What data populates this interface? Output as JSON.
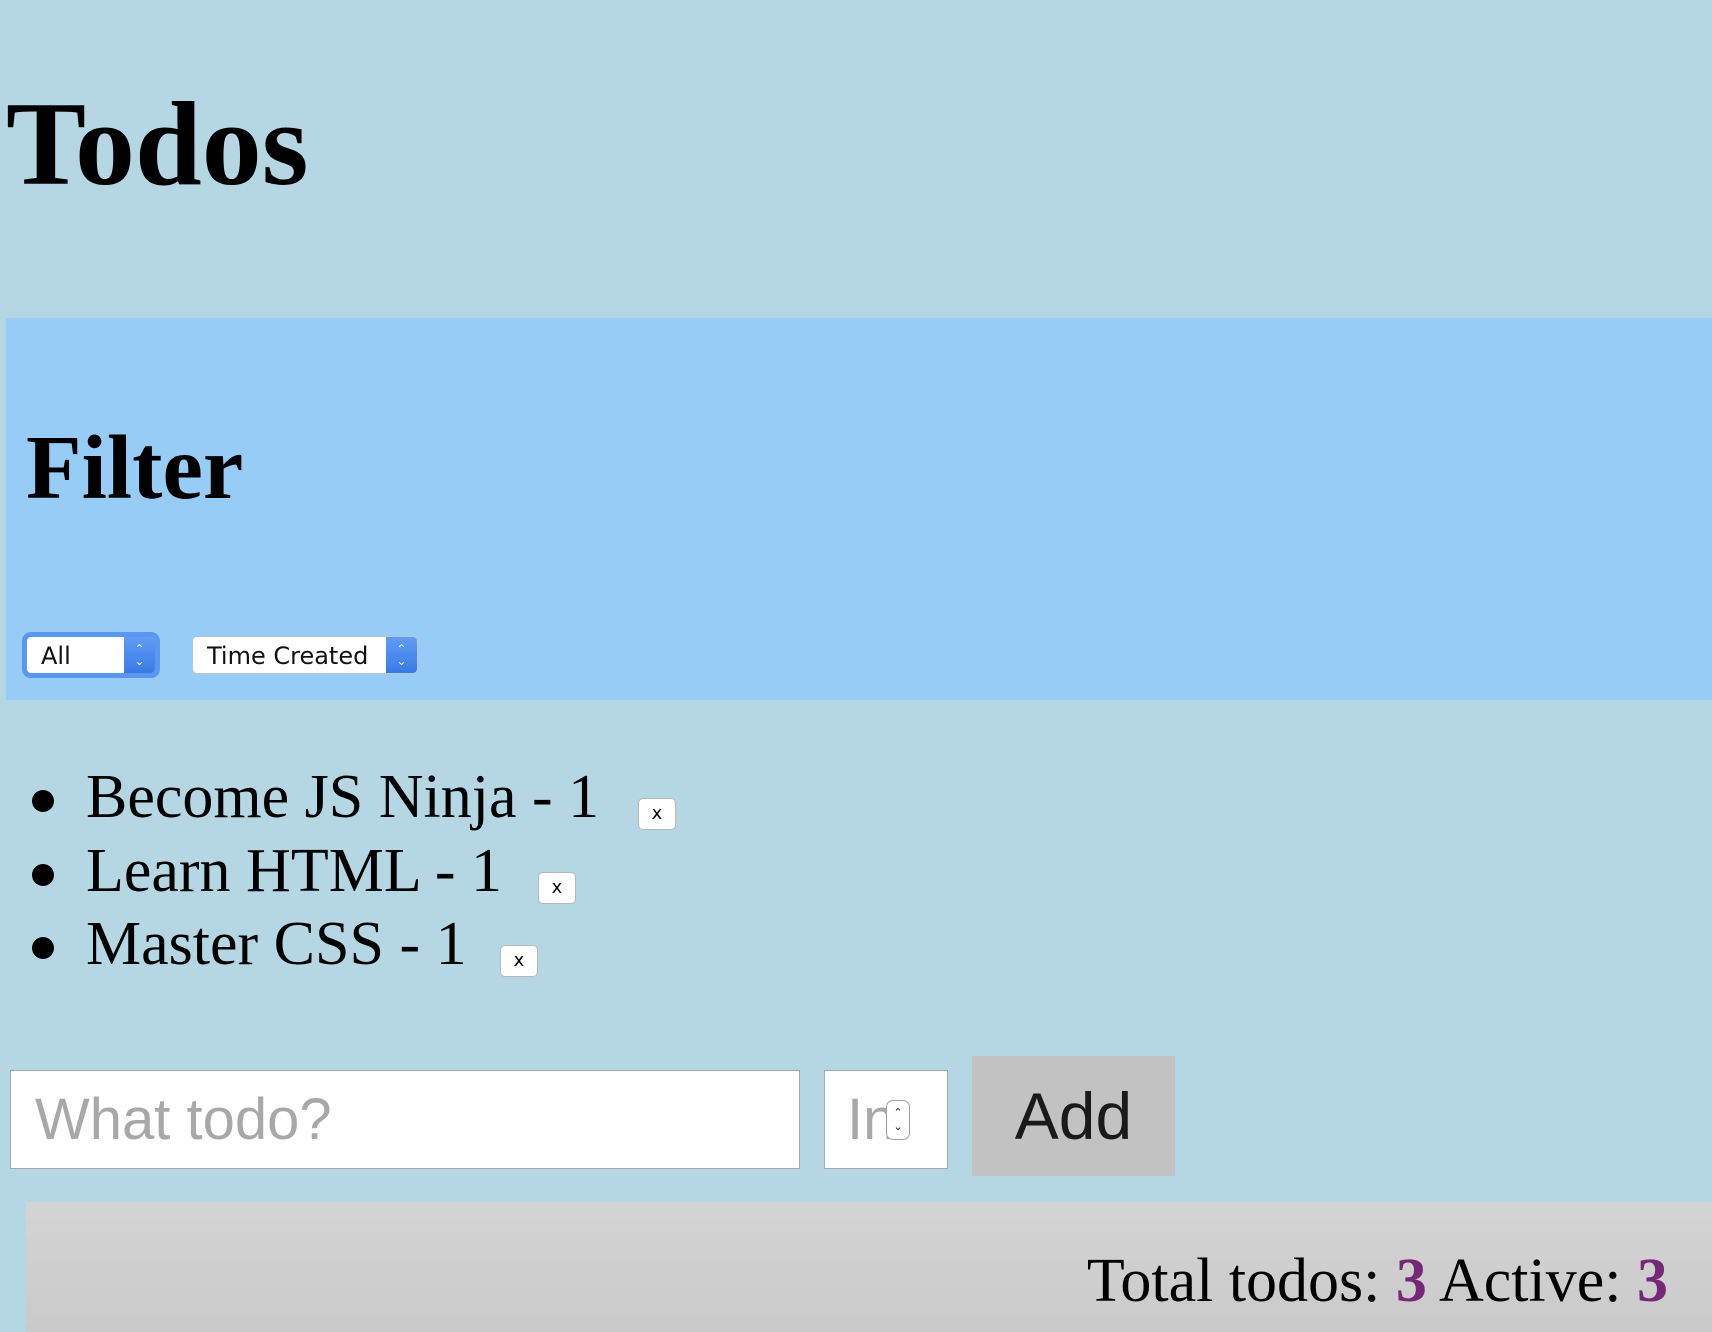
{
  "header": {
    "title": "Todos"
  },
  "filter": {
    "heading": "Filter",
    "status_select": {
      "selected": "All"
    },
    "sort_select": {
      "selected": "Time Created"
    }
  },
  "todos": [
    {
      "text": "Become JS Ninja - 1",
      "delete_label": "x"
    },
    {
      "text": "Learn HTML - 1",
      "delete_label": "x"
    },
    {
      "text": "Master CSS - 1",
      "delete_label": "x"
    }
  ],
  "form": {
    "todo_placeholder": "What todo?",
    "priority_placeholder": "Insert priority",
    "add_label": "Add"
  },
  "footer": {
    "total_label": "Total todos:",
    "total_count": "3",
    "active_label": "Active:",
    "active_count": "3"
  },
  "colors": {
    "page_background": "#b5d7e3",
    "filter_background": "#96ccf5",
    "footer_background": "#d4d4d4",
    "count_color": "#762878",
    "select_accent": "#3a7ae6"
  }
}
